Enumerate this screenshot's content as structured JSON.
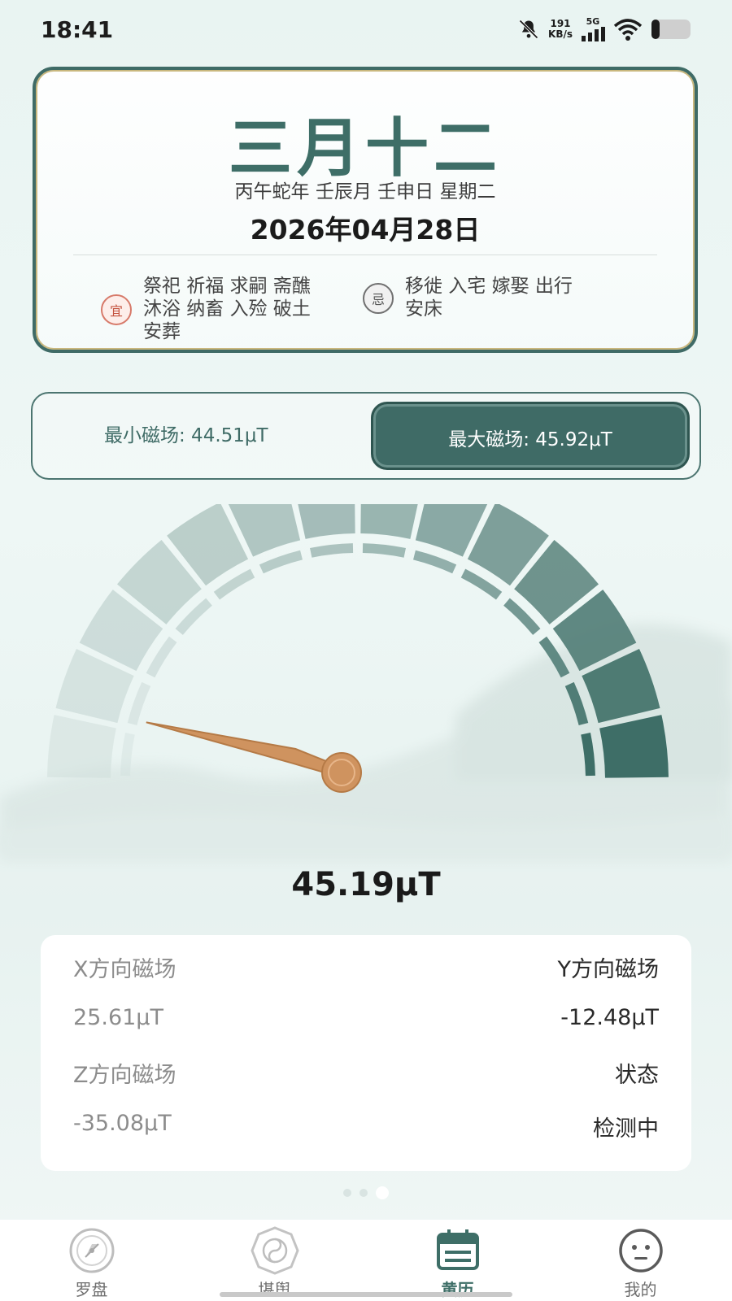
{
  "status_bar": {
    "time": "18:41",
    "net_speed_value": "191",
    "net_speed_unit": "KB/s",
    "net_type": "5G",
    "icons": [
      "bell-off-icon",
      "signal-icon",
      "wifi-icon",
      "battery-icon"
    ]
  },
  "almanac": {
    "lunar_date": "三月十二",
    "ganzhi": "丙午蛇年 壬辰月 壬申日 星期二",
    "solar_date": "2026年04月28日",
    "yi_badge": "宜",
    "yi_line1": "祭祀 祈福 求嗣 斋醮",
    "yi_line2": "沐浴 纳畜 入殓 破土",
    "yi_line3": "安葬",
    "ji_badge": "忌",
    "ji_line1": "移徙 入宅 嫁娶 出行",
    "ji_line2": "安床",
    "colors": {
      "accent": "#3e6e67",
      "yi": "#c4523e"
    }
  },
  "range": {
    "min_label": "最小磁场: 44.51μT",
    "max_label": "最大磁场: 45.92μT"
  },
  "gauge": {
    "value_text": "45.19μT",
    "level_fraction": 0.08,
    "segments": 14,
    "needle_color": "#cf935f"
  },
  "readings": {
    "x_label": "X方向磁场",
    "y_label": "Y方向磁场",
    "x_value": "25.61μT",
    "y_value": "-12.48μT",
    "z_label": "Z方向磁场",
    "status_label": "状态",
    "z_value": "-35.08μT",
    "status_value": "检测中"
  },
  "tabs": [
    {
      "label": "罗盘",
      "icon": "compass-icon"
    },
    {
      "label": "堪舆",
      "icon": "bagua-icon"
    },
    {
      "label": "黄历",
      "icon": "calendar-icon"
    },
    {
      "label": "我的",
      "icon": "face-icon"
    }
  ]
}
